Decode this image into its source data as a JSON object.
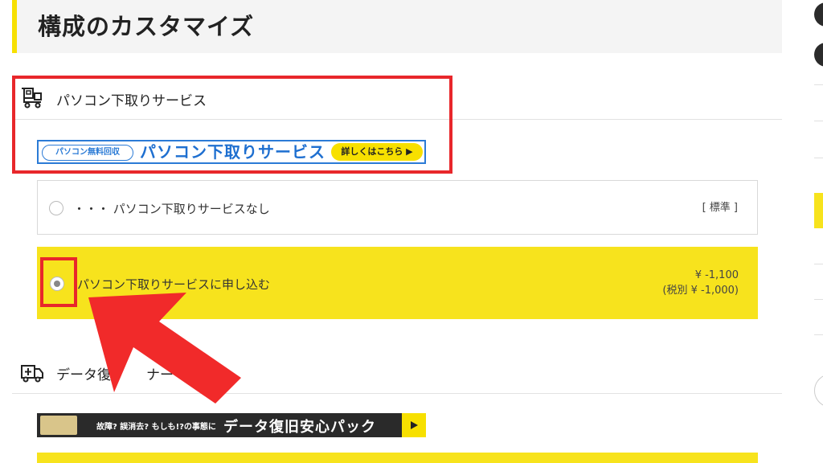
{
  "section": {
    "title": "構成のカスタマイズ"
  },
  "trade_in": {
    "group_label": "パソコン下取りサービス",
    "banner": {
      "pill": "パソコン無料回収",
      "title": "パソコン下取りサービス",
      "button": "詳しくはこちら ▶"
    },
    "options": [
      {
        "label": "・・・ パソコン下取りサービスなし",
        "right": "[ 標準 ]",
        "selected": false
      },
      {
        "label": "パソコン下取りサービスに申し込む",
        "price": "¥ -1,100",
        "price_tax": "(税別 ¥ -1,000)",
        "selected": true
      }
    ]
  },
  "data_recovery": {
    "group_label": "データ復",
    "group_label_tail": "ナー",
    "banner": {
      "small": "故障? 誤消去? もしも!?の事態に",
      "big": "データ復旧安心パック"
    }
  },
  "annotation": {
    "highlight_color": "#e8272b",
    "accent": "#f7e31d"
  }
}
